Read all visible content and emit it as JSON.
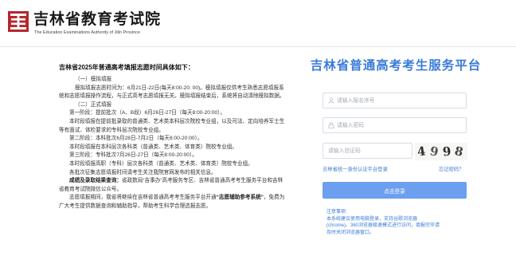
{
  "header": {
    "site_title": "吉林省教育考试院",
    "site_subtitle": "The Education Examinations Authority of Jilin Province"
  },
  "notice": {
    "title": "吉林省2025年普通高考填报志愿时间具体如下：",
    "lines": [
      "（一）模拟填报",
      "模拟填报志愿时间为：6月21日-22日(每天8:00-20: 00)。模拟填报仅供考生熟悉志愿填报系统和志愿填报操作流程，与正式高考志愿填报无关。模拟填报结束后，系统将自动清除模拟数据。",
      "（二）正式填报",
      "第一阶段：提前批次（A、B段）6月26日-27日（每天8:00-20:00）。",
      "本时段填报在提前批录取的普通类、艺术类本科层次院校专业组，以及司法、定向培养军士生等有面试、体检要求的专科层次院校专业组。",
      "第二阶段：本科批次6月28日-7月2日（每天8:00-20:00）。",
      "本时段填报在本科层次各科类（普通类、艺术类、体育类）院校专业组。",
      "第三阶段：专科批次7月26日-27日（每天8:00-20:00）。",
      "本时段填报高职（专科）层次各科类（普通类、艺术类、体育类）院校专业组。",
      "各批次征集志愿填报时间请考生关注我院官网发布的相关信息。"
    ],
    "bold_label": "咸绩及录取结果查询：",
    "bold_text": "省政数局“吉事办”高考服务专区、吉林省普通高考考生服务平台和吉林省教育考试院微信公众号。",
    "para_pre": "志愿填报期间，我省将继续在吉林省普通高考考生服务平台开通",
    "para_bold": "“志愿辅助参考系统”",
    "para_post": "，免费为广大考生提供数据查询和辅助指导，帮助考生科学合理选报志愿。"
  },
  "login": {
    "platform_title": "吉林省普通高考考生服务平台",
    "username_placeholder": "请输入报名序号",
    "password_placeholder": "请输入密码",
    "captcha_placeholder": "请输入验证码",
    "captcha_text": [
      "4",
      "9",
      "9",
      "8"
    ],
    "auth_link": "吉林省统一身份认证平台登录",
    "forgot_link": "忘记密码？",
    "login_button": "点击登录",
    "accent_color": "#3b7bd8",
    "button_color": "#6d9ff0"
  },
  "tips": {
    "title": "注意事项:",
    "line1": "本系统建议使用电脑登录，支持谷歌浏览器",
    "line2": "(chrome)、360浏览器极速模式进行访问，填报完毕请",
    "line3": "及时关闭浏览器窗口。"
  }
}
